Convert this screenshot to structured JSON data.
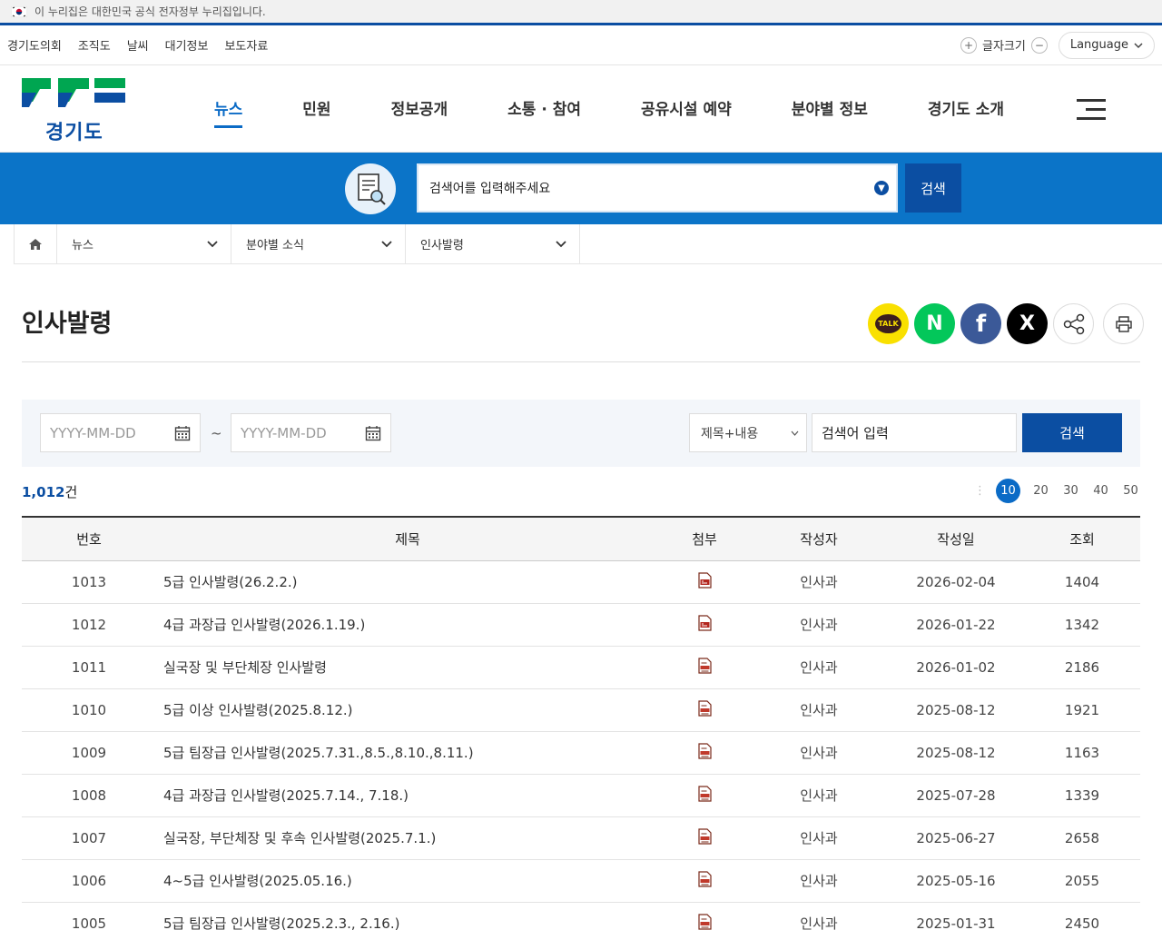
{
  "gov_banner": {
    "text": "이 누리집은 대한민국 공식 전자정부 누리집입니다."
  },
  "utility": {
    "links": [
      "경기도의회",
      "조직도",
      "날씨",
      "대기정보",
      "보도자료"
    ],
    "font_size_label": "글자크기",
    "language_label": "Language"
  },
  "header": {
    "logo_text": "경기도",
    "nav": [
      "뉴스",
      "민원",
      "정보공개",
      "소통 · 참여",
      "공유시설 예약",
      "분야별 정보",
      "경기도 소개"
    ],
    "active_nav": "뉴스"
  },
  "search": {
    "placeholder": "검색어를 입력해주세요",
    "button": "검색"
  },
  "breadcrumb": [
    "뉴스",
    "분야별 소식",
    "인사발령"
  ],
  "page": {
    "title": "인사발령"
  },
  "share": {
    "kakao_label": "TALK",
    "naver_label": "N",
    "facebook_label": "f",
    "x_label": "X"
  },
  "filter": {
    "date_from_placeholder": "YYYY-MM-DD",
    "date_to_placeholder": "YYYY-MM-DD",
    "separator": "~",
    "scope": "제목+내용",
    "keyword_placeholder": "검색어 입력",
    "button": "검색"
  },
  "list": {
    "count": "1,012",
    "count_unit": "건",
    "page_sizes": [
      "10",
      "20",
      "30",
      "40",
      "50"
    ],
    "active_page_size": "10",
    "columns": [
      "번호",
      "제목",
      "첨부",
      "작성자",
      "작성일",
      "조회"
    ],
    "rows": [
      {
        "no": "1013",
        "title": "5급 인사발령(26.2.2.)",
        "file": "pdf",
        "author": "인사과",
        "date": "2026-02-04",
        "views": "1404"
      },
      {
        "no": "1012",
        "title": "4급 과장급 인사발령(2026.1.19.)",
        "file": "pdf",
        "author": "인사과",
        "date": "2026-01-22",
        "views": "1342"
      },
      {
        "no": "1011",
        "title": "실국장 및 부단체장 인사발령",
        "file": "doc",
        "author": "인사과",
        "date": "2026-01-02",
        "views": "2186"
      },
      {
        "no": "1010",
        "title": "5급 이상 인사발령(2025.8.12.)",
        "file": "doc",
        "author": "인사과",
        "date": "2025-08-12",
        "views": "1921"
      },
      {
        "no": "1009",
        "title": "5급 팀장급 인사발령(2025.7.31.,8.5.,8.10.,8.11.)",
        "file": "doc",
        "author": "인사과",
        "date": "2025-08-12",
        "views": "1163"
      },
      {
        "no": "1008",
        "title": "4급 과장급 인사발령(2025.7.14., 7.18.)",
        "file": "doc",
        "author": "인사과",
        "date": "2025-07-28",
        "views": "1339"
      },
      {
        "no": "1007",
        "title": "실국장, 부단체장 및 후속 인사발령(2025.7.1.)",
        "file": "doc",
        "author": "인사과",
        "date": "2025-06-27",
        "views": "2658"
      },
      {
        "no": "1006",
        "title": "4~5급 인사발령(2025.05.16.)",
        "file": "doc",
        "author": "인사과",
        "date": "2025-05-16",
        "views": "2055"
      },
      {
        "no": "1005",
        "title": "5급 팀장급 인사발령(2025.2.3., 2.16.)",
        "file": "doc",
        "author": "인사과",
        "date": "2025-01-31",
        "views": "2450"
      }
    ]
  },
  "colors": {
    "primary": "#0b4ea2",
    "band": "#0b74c8",
    "accent": "#0b6bc6",
    "logo_green": "#00a651"
  }
}
